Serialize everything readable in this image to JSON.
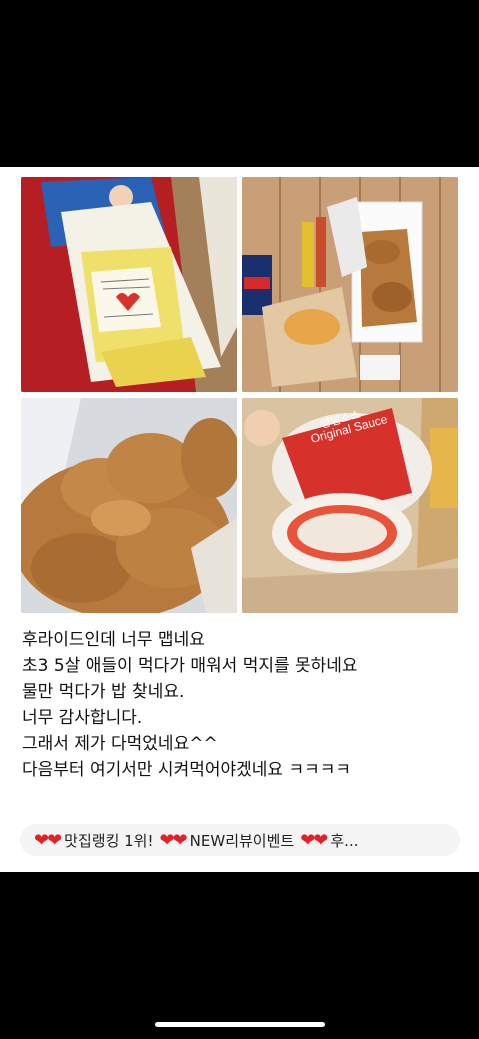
{
  "review": {
    "lines": [
      "후라이드인데 너무 맵네요",
      "초3 5살 애들이 먹다가 매워서 먹지를 못하네요",
      "물만 먹다가 밥 찾네요.",
      "너무 감사합니다.",
      "그래서 제가 다먹었네요^^",
      "다음부터 여기서만 시켜먹어야겠네요 ㅋㅋㅋㅋ"
    ]
  },
  "banner": {
    "segments": [
      "맛집랭킹 1위!",
      "NEW리뷰이벤트",
      "후..."
    ],
    "heart_color": "#e0222c"
  },
  "photos": {
    "top_left": {
      "label": "Delivery receipt and handwritten note",
      "sauce_text": ""
    },
    "top_right": {
      "label": "Chicken box with cola and fries"
    },
    "bottom_left": {
      "label": "Close-up fried chicken"
    },
    "bottom_right": {
      "label": "Original Sauce cups",
      "sauce_label": "Original Sauce",
      "sauce_korean": "양념소스"
    }
  },
  "colors": {
    "background": "#000000",
    "card": "#ffffff",
    "banner_bg": "#f4f4f4"
  }
}
